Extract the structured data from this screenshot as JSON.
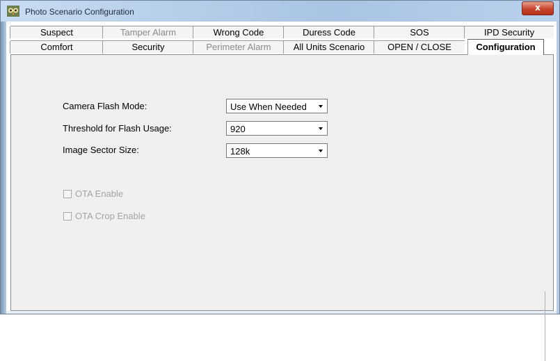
{
  "window": {
    "title": "Photo Scenario Configuration",
    "close_glyph": "x"
  },
  "tabs": {
    "row1": [
      {
        "label": "Suspect",
        "enabled": true
      },
      {
        "label": "Tamper Alarm",
        "enabled": false
      },
      {
        "label": "Wrong Code",
        "enabled": true
      },
      {
        "label": "Duress Code",
        "enabled": true
      },
      {
        "label": "SOS",
        "enabled": true
      },
      {
        "label": "IPD Security",
        "enabled": true
      }
    ],
    "row2": [
      {
        "label": "Comfort",
        "enabled": true
      },
      {
        "label": "Security",
        "enabled": true
      },
      {
        "label": "Perimeter Alarm",
        "enabled": false
      },
      {
        "label": "All Units Scenario",
        "enabled": true
      },
      {
        "label": "OPEN / CLOSE",
        "enabled": true
      },
      {
        "label": "Configuration",
        "enabled": true,
        "selected": true
      }
    ]
  },
  "config": {
    "flash_mode_label": "Camera Flash Mode:",
    "flash_mode_value": "Use When Needed",
    "threshold_label": "Threshold for Flash Usage:",
    "threshold_value": "920",
    "sector_label": "Image Sector Size:",
    "sector_value": "128k",
    "ota_enable_label": "OTA Enable",
    "ota_enable_checked": false,
    "ota_crop_label": "OTA Crop Enable",
    "ota_crop_checked": false
  },
  "colors": {
    "title_bar": "#b4cde9",
    "close_button": "#c7452d",
    "panel_bg": "#f0f0f0",
    "disabled_text": "#8a8a8a"
  },
  "icons": {
    "app": "owl-app-icon",
    "close": "close-icon",
    "dropdown": "dropdown-arrow-icon"
  }
}
